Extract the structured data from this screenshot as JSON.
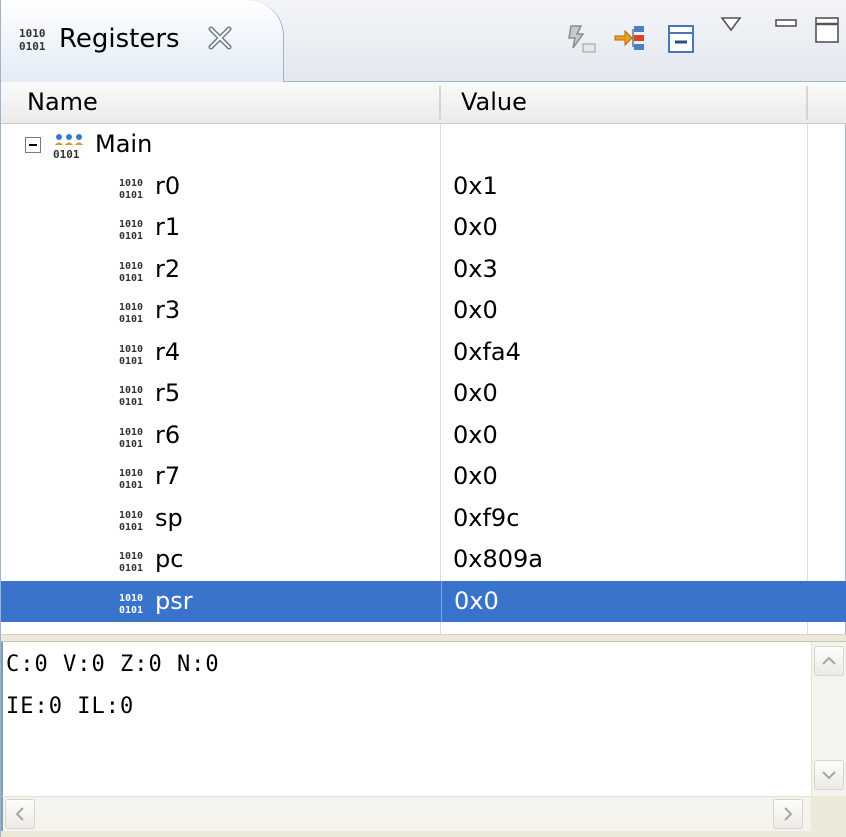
{
  "tab": {
    "title": "Registers",
    "icon": "registers-binary-icon"
  },
  "toolbar": {
    "icons": [
      "clear-icon",
      "goto-icon",
      "collapse-all-icon",
      "view-menu-icon",
      "minimize-icon",
      "maximize-icon"
    ]
  },
  "columns": {
    "name": "Name",
    "value": "Value"
  },
  "group": {
    "name": "Main",
    "expanded": true
  },
  "registers": [
    {
      "name": "r0",
      "value": "0x1"
    },
    {
      "name": "r1",
      "value": "0x0"
    },
    {
      "name": "r2",
      "value": "0x3"
    },
    {
      "name": "r3",
      "value": "0x0"
    },
    {
      "name": "r4",
      "value": "0xfa4"
    },
    {
      "name": "r5",
      "value": "0x0"
    },
    {
      "name": "r6",
      "value": "0x0"
    },
    {
      "name": "r7",
      "value": "0x0"
    },
    {
      "name": "sp",
      "value": "0xf9c"
    },
    {
      "name": "pc",
      "value": "0x809a"
    },
    {
      "name": "psr",
      "value": "0x0",
      "selected": true
    }
  ],
  "details": {
    "lines": [
      "C:0 V:0 Z:0 N:0",
      "IE:0 IL:0"
    ]
  },
  "colors": {
    "selection": "#3a73cc",
    "border": "#9fb4cc"
  }
}
